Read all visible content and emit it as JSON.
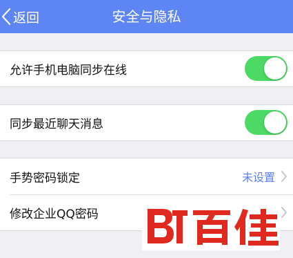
{
  "nav": {
    "back_label": "返回",
    "title": "安全与隐私"
  },
  "sections": [
    {
      "label": "允许手机电脑同步在线",
      "toggle_on": true
    },
    {
      "label": "同步最近聊天消息",
      "toggle_on": true
    }
  ],
  "settings": {
    "gesture_lock": {
      "label": "手势密码锁定",
      "value": "未设置"
    },
    "change_password": {
      "label": "修改企业QQ密码"
    }
  },
  "watermark": {
    "brand_text": "百佳",
    "logo_letters": "BT"
  },
  "colors": {
    "navbar": "#5d86f4",
    "toggle_on": "#4cd964",
    "value_text": "#5a7ff0",
    "watermark": "#e0291f"
  }
}
